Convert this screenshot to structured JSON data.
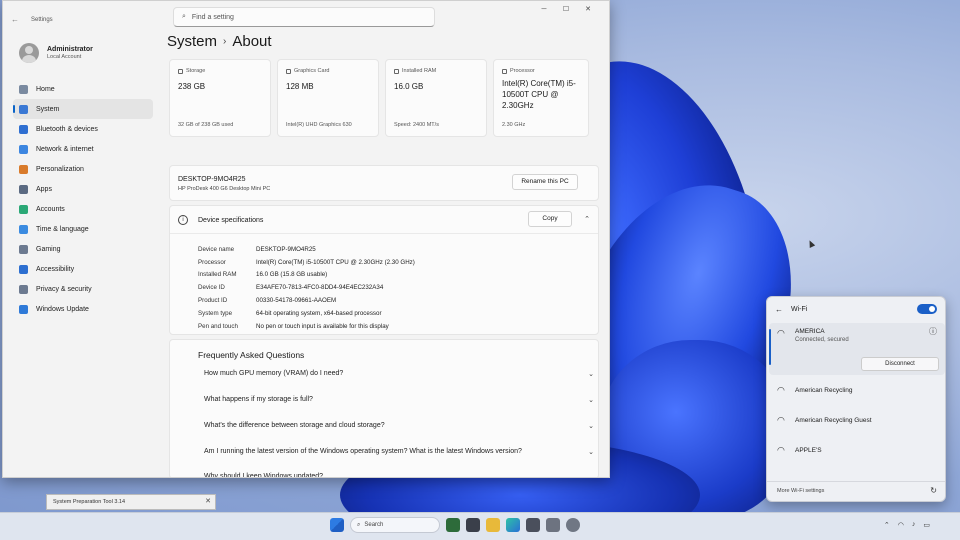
{
  "settings": {
    "app_title": "Settings",
    "search_placeholder": "Find a setting",
    "user": {
      "name": "Administrator",
      "role": "Local Account"
    },
    "nav": [
      {
        "label": "Home",
        "icon": "home-icon",
        "color": "#7a8aa0"
      },
      {
        "label": "System",
        "icon": "system-icon",
        "color": "#3a78d4",
        "active": true
      },
      {
        "label": "Bluetooth & devices",
        "icon": "bluetooth-icon",
        "color": "#2f6fd1"
      },
      {
        "label": "Network & internet",
        "icon": "network-icon",
        "color": "#3d86e0"
      },
      {
        "label": "Personalization",
        "icon": "brush-icon",
        "color": "#d97b2b"
      },
      {
        "label": "Apps",
        "icon": "apps-icon",
        "color": "#5b6a82"
      },
      {
        "label": "Accounts",
        "icon": "accounts-icon",
        "color": "#2aa876"
      },
      {
        "label": "Time & language",
        "icon": "clock-icon",
        "color": "#3b8be0"
      },
      {
        "label": "Gaming",
        "icon": "gaming-icon",
        "color": "#6c7a90"
      },
      {
        "label": "Accessibility",
        "icon": "accessibility-icon",
        "color": "#2d6fd0"
      },
      {
        "label": "Privacy & security",
        "icon": "shield-icon",
        "color": "#6c7a90"
      },
      {
        "label": "Windows Update",
        "icon": "update-icon",
        "color": "#2f7ad8"
      }
    ],
    "breadcrumb": {
      "parent": "System",
      "current": "About"
    },
    "cards": [
      {
        "label": "Storage",
        "value": "238 GB",
        "sub": "32 GB of 238 GB used"
      },
      {
        "label": "Graphics Card",
        "value": "128 MB",
        "sub": "Intel(R) UHD Graphics 630"
      },
      {
        "label": "Installed RAM",
        "value": "16.0 GB",
        "sub": "Speed: 2400 MT/s"
      },
      {
        "label": "Processor",
        "value": "Intel(R) Core(TM) i5-10500T CPU @ 2.30GHz",
        "sub": "2.30 GHz"
      }
    ],
    "pc": {
      "name": "DESKTOP-9MO4R25",
      "model": "HP ProDesk 400 G6 Desktop Mini PC",
      "rename_label": "Rename this PC"
    },
    "specs": {
      "title": "Device specifications",
      "copy_label": "Copy",
      "rows": [
        {
          "k": "Device name",
          "v": "DESKTOP-9MO4R25"
        },
        {
          "k": "Processor",
          "v": "Intel(R) Core(TM) i5-10500T CPU @ 2.30GHz (2.30 GHz)"
        },
        {
          "k": "Installed RAM",
          "v": "16.0 GB (15.8 GB usable)"
        },
        {
          "k": "Device ID",
          "v": "E34AFE70-7813-4FC0-8DD4-94E4EC232A34"
        },
        {
          "k": "Product ID",
          "v": "00330-54178-09661-AAOEM"
        },
        {
          "k": "System type",
          "v": "64-bit operating system, x64-based processor"
        },
        {
          "k": "Pen and touch",
          "v": "No pen or touch input is available for this display"
        }
      ]
    },
    "faq": {
      "title": "Frequently Asked Questions",
      "items": [
        "How much GPU memory (VRAM) do I need?",
        "What happens if my storage is full?",
        "What's the difference between storage and cloud storage?",
        "Am I running the latest version of the Windows operating system? What is the latest Windows version?",
        "Why should I keep Windows updated?"
      ]
    }
  },
  "wifi": {
    "title": "Wi-Fi",
    "connected": {
      "name": "AMERICA",
      "status": "Connected, secured",
      "disconnect_label": "Disconnect"
    },
    "networks": [
      "American Recycling",
      "American Recycling Guest",
      "APPLE'S"
    ],
    "more_label": "More Wi-Fi settings"
  },
  "taskbar": {
    "search_label": "Search"
  },
  "sysprep": {
    "label": "System Preparation Tool 3.14"
  }
}
